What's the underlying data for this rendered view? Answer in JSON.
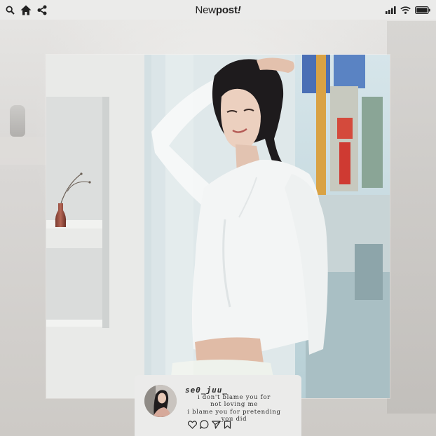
{
  "app": {
    "title_regular": "New",
    "title_bold": "post",
    "title_mark": "!"
  },
  "status_bar": {
    "left_icons": [
      "search-icon",
      "home-icon",
      "share-icon"
    ],
    "right_icons": [
      "signal-icon",
      "wifi-icon",
      "battery-icon"
    ]
  },
  "post": {
    "username": "se0_juu_",
    "caption_lines": [
      "i don't blame you for",
      "not loving me",
      "i blame you for pretending",
      "you did"
    ],
    "actions": [
      "heart-icon",
      "comment-icon",
      "send-icon",
      "bookmark-icon"
    ]
  },
  "colors": {
    "bar": "#ebebea",
    "text": "#222222"
  }
}
